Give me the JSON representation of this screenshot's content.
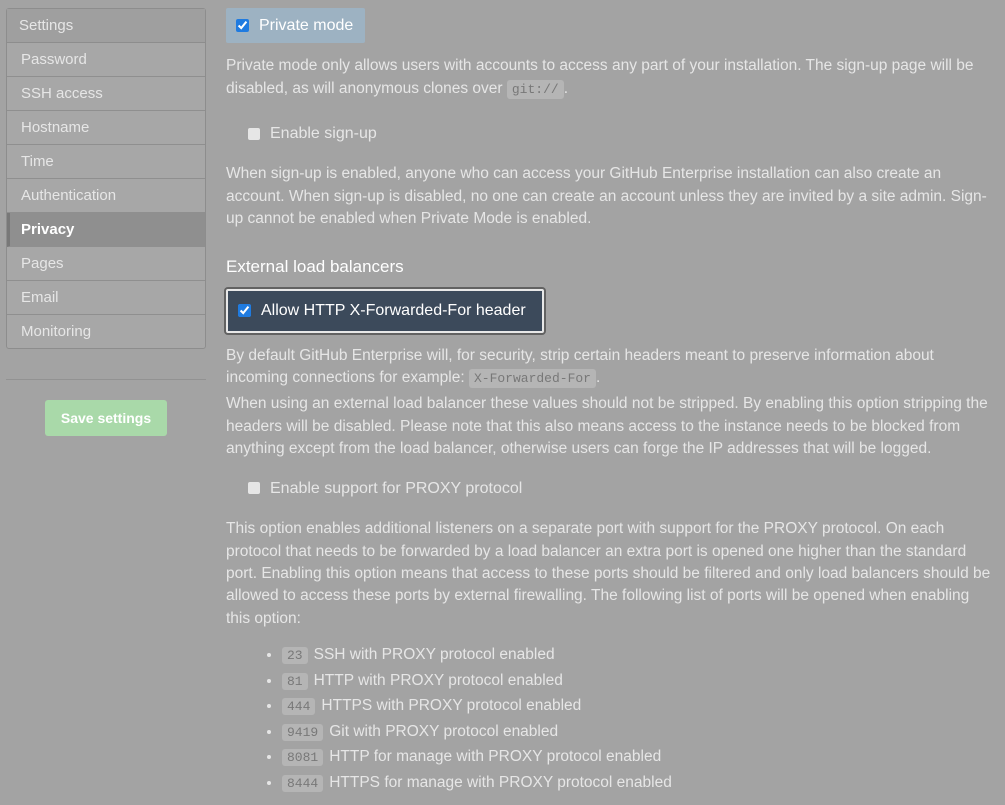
{
  "sidebar": {
    "title": "Settings",
    "items": [
      {
        "label": "Password"
      },
      {
        "label": "SSH access"
      },
      {
        "label": "Hostname"
      },
      {
        "label": "Time"
      },
      {
        "label": "Authentication"
      },
      {
        "label": "Privacy",
        "active": true
      },
      {
        "label": "Pages"
      },
      {
        "label": "Email"
      },
      {
        "label": "Monitoring"
      }
    ],
    "save_label": "Save settings"
  },
  "privacy": {
    "private_mode": {
      "label": "Private mode",
      "checked": true,
      "desc_prefix": "Private mode only allows users with accounts to access any part of your installation. The sign-up page will be disabled, as will anonymous clones over ",
      "code": "git://",
      "desc_suffix": "."
    },
    "signup": {
      "label": "Enable sign-up",
      "checked": false,
      "desc": "When sign-up is enabled, anyone who can access your GitHub Enterprise installation can also create an account. When sign-up is disabled, no one can create an account unless they are invited by a site admin. Sign-up cannot be enabled when Private Mode is enabled."
    },
    "elb": {
      "heading": "External load balancers",
      "xff": {
        "label": "Allow HTTP X-Forwarded-For header",
        "checked": true,
        "desc_prefix": "By default GitHub Enterprise will, for security, strip certain headers meant to preserve information about incoming connections for example: ",
        "code": "X-Forwarded-For",
        "desc_suffix": ".",
        "desc2": "When using an external load balancer these values should not be stripped. By enabling this option stripping the headers will be disabled. Please note that this also means access to the instance needs to be blocked from anything except from the load balancer, otherwise users can forge the IP addresses that will be logged."
      },
      "proxy": {
        "label": "Enable support for PROXY protocol",
        "checked": false,
        "desc": "This option enables additional listeners on a separate port with support for the PROXY protocol. On each protocol that needs to be forwarded by a load balancer an extra port is opened one higher than the standard port. Enabling this option means that access to these ports should be filtered and only load balancers should be allowed to access these ports by external firewalling. The following list of ports will be opened when enabling this option:",
        "ports": [
          {
            "port": "23",
            "text": "SSH with PROXY protocol enabled"
          },
          {
            "port": "81",
            "text": "HTTP with PROXY protocol enabled"
          },
          {
            "port": "444",
            "text": "HTTPS with PROXY protocol enabled"
          },
          {
            "port": "9419",
            "text": "Git with PROXY protocol enabled"
          },
          {
            "port": "8081",
            "text": "HTTP for manage with PROXY protocol enabled"
          },
          {
            "port": "8444",
            "text": "HTTPS for manage with PROXY protocol enabled"
          }
        ]
      }
    }
  }
}
